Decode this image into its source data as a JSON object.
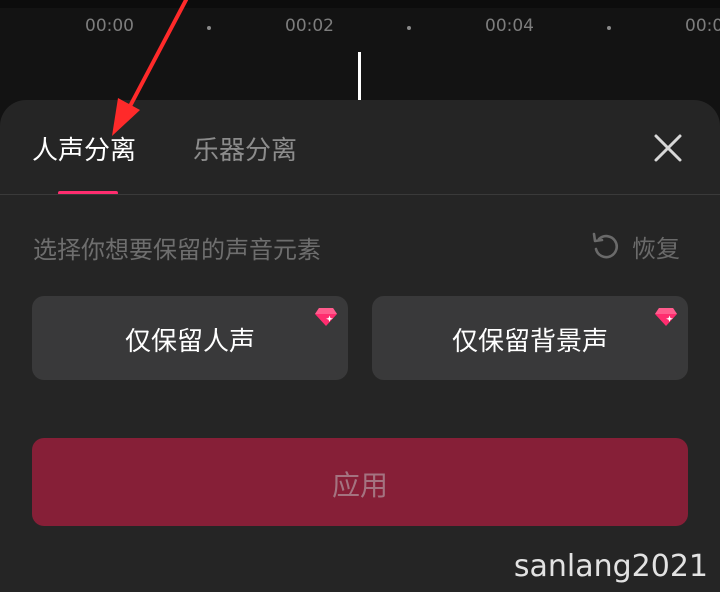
{
  "timeline": {
    "ticks": [
      "00:00",
      "00:02",
      "00:04",
      "00:0"
    ]
  },
  "panel": {
    "tabs": [
      {
        "label": "人声分离",
        "active": true
      },
      {
        "label": "乐器分离",
        "active": false
      }
    ],
    "prompt": "选择你想要保留的声音元素",
    "restore_label": "恢复",
    "options": [
      {
        "label": "仅保留人声",
        "badge": "gem-icon"
      },
      {
        "label": "仅保留背景声",
        "badge": "gem-icon"
      }
    ],
    "apply_label": "应用"
  },
  "watermark": "sanlang2021",
  "colors": {
    "accent": "#ff2d6f",
    "apply_bg": "#861f37",
    "panel_bg": "#252525",
    "option_bg": "#39393a",
    "annotation_arrow": "#ff2a2a"
  }
}
